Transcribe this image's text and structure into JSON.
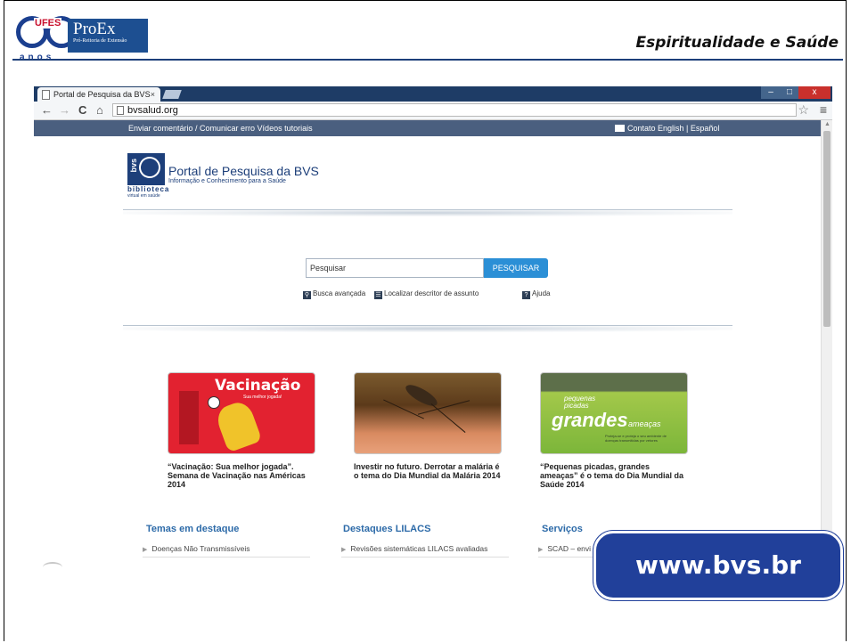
{
  "slide": {
    "title": "Espiritualidade e Saúde",
    "logo": {
      "ufes": "UFES",
      "proex": "ProEx",
      "proex_sub": "Pró-Reitoria de Extensão",
      "anos": "anos",
      "number": "60"
    },
    "callout": "www.bvs.br"
  },
  "browser": {
    "tab_title": "Portal de Pesquisa da BVS",
    "tab_close": "×",
    "url": "bvsalud.org",
    "nav": {
      "back": "←",
      "forward": "→",
      "reload": "C",
      "home": "⌂"
    },
    "window_controls": {
      "minimize": "–",
      "maximize": "□",
      "close": "x"
    },
    "star": "☆",
    "menu": "≡"
  },
  "site": {
    "topbar_left": "Enviar comentário / Comunicar erro   Vídeos tutoriais",
    "topbar_right": "Contato   English  | Español",
    "logo": {
      "name": "Portal de Pesquisa da BVS",
      "tagline": "Informação e Conhecimento para a Saúde",
      "bvs": "bvs",
      "biblioteca": "biblioteca",
      "virtual": "virtual em saúde"
    },
    "search": {
      "placeholder": "Pesquisar",
      "button": "PESQUISAR"
    },
    "links": {
      "advanced": "Busca avançada",
      "descriptor": "Localizar descritor de assunto",
      "help": "Ajuda"
    },
    "features": [
      {
        "caption": "“Vacinação: Sua melhor jogada”. Semana de Vacinação nas Américas 2014",
        "img_title": "Vacinação",
        "img_sub": "Sua melhor jogada!"
      },
      {
        "caption": "Investir no futuro. Derrotar a malária é o tema do Dia Mundial da Malária 2014"
      },
      {
        "caption": "“Pequenas picadas, grandes ameaças” é o tema do Dia Mundial da Saúde 2014",
        "img_l1": "pequenas",
        "img_l2": "picadas",
        "img_l3": "grandes",
        "img_l4": "ameaças",
        "img_l5": "Proteja-se e proteja o seu ambiente de doenças transmitidas por vetores"
      }
    ],
    "sections": [
      {
        "title": "Temas em destaque",
        "item": "Doenças Não Transmissíveis"
      },
      {
        "title": "Destaques LILACS",
        "item": "Revisões sistemáticas LILACS avaliadas"
      },
      {
        "title": "Serviços",
        "item": "SCAD – envi"
      }
    ]
  },
  "colors": {
    "slide_rule": "#1d3f7a",
    "site_topbar": "#4a5f7f",
    "search_button": "#2b8fd6",
    "section_title": "#2c6aa8",
    "callout": "#21409a"
  }
}
